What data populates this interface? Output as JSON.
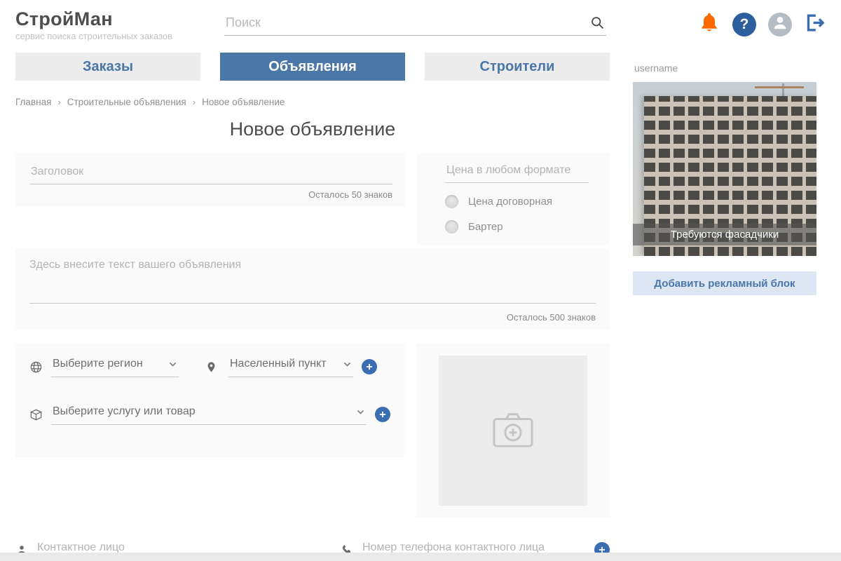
{
  "header": {
    "logo_title": "СтройМан",
    "logo_subtitle": "сервис поиска строительных заказов",
    "search_placeholder": "Поиск",
    "help_glyph": "?"
  },
  "tabs": [
    {
      "label": "Заказы"
    },
    {
      "label": "Объявления"
    },
    {
      "label": "Строители"
    }
  ],
  "breadcrumb": {
    "items": [
      "Главная",
      "Строительные объявления",
      "Новое объявление"
    ],
    "separator": "›"
  },
  "page_title": "Новое объявление",
  "form": {
    "title_placeholder": "Заголовок",
    "title_counter": "Осталось 50 знаков",
    "price_placeholder": "Цена в любом формате",
    "price_options": [
      "Цена договорная",
      "Бартер"
    ],
    "text_placeholder": "Здесь внесите текст вашего объявления",
    "text_counter": "Осталось 500 знаков",
    "region_placeholder": "Выберите регион",
    "city_placeholder": "Населенный пункт",
    "service_placeholder": "Выберите услугу или товар",
    "contact_placeholder": "Контактное лицо",
    "phone_placeholder": "Номер телефона контактного лица"
  },
  "sidebar": {
    "username": "username",
    "ad_caption": "Требуются фасадчики",
    "add_block_label": "Добавить рекламный блок"
  },
  "colors": {
    "accent": "#4a76a8",
    "bell": "#ff6a00",
    "help_bg": "#2d5f9e"
  }
}
